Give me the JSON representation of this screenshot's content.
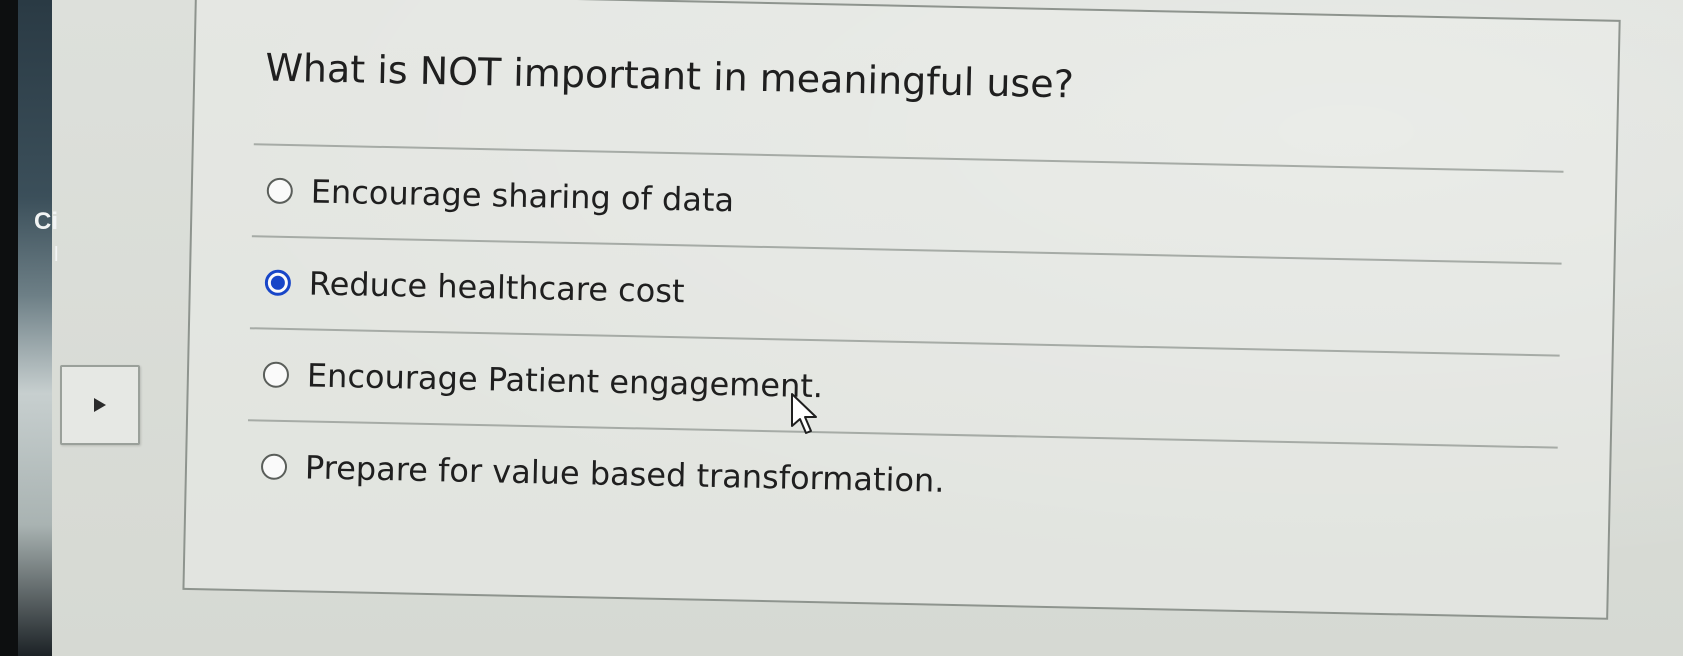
{
  "left_edge": {
    "text_a": "Ci",
    "text_b": "l"
  },
  "side_tab": {
    "icon": "play-icon"
  },
  "question": {
    "text": "What is NOT important in meaningful use?"
  },
  "options": [
    {
      "label": "Encourage sharing of data",
      "selected": false
    },
    {
      "label": "Reduce healthcare cost",
      "selected": true
    },
    {
      "label": "Encourage Patient engagement.",
      "selected": false
    },
    {
      "label": "Prepare for value based transformation.",
      "selected": false
    }
  ],
  "colors": {
    "accent": "#1846c8",
    "text": "#1f1f1f",
    "border": "#8e948e"
  },
  "cursor": {
    "icon": "mouse-pointer-icon"
  }
}
